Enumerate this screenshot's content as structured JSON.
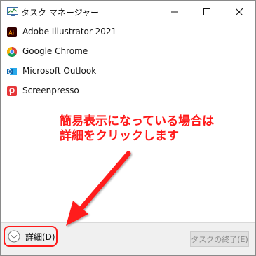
{
  "window": {
    "title": "タスク マネージャー"
  },
  "apps": [
    {
      "label": "Adobe Illustrator 2021",
      "icon": "adobe-illustrator-icon"
    },
    {
      "label": "Google Chrome",
      "icon": "chrome-icon"
    },
    {
      "label": "Microsoft Outlook",
      "icon": "outlook-icon"
    },
    {
      "label": "Screenpresso",
      "icon": "screenpresso-icon"
    }
  ],
  "annotation": {
    "line1": "簡易表示になっている場合は",
    "line2": "詳細をクリックします",
    "color": "#ff1a1a"
  },
  "footer": {
    "details_label": "詳細(D)",
    "end_task_label": "タスクの終了(E)"
  }
}
